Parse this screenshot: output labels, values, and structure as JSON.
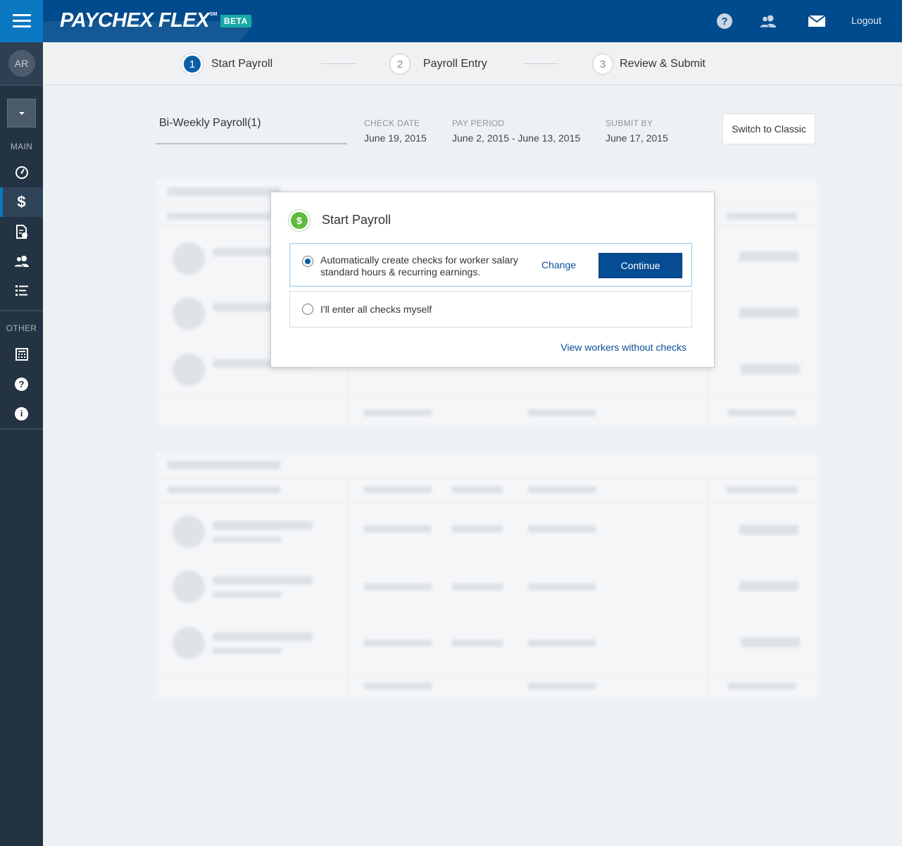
{
  "app": {
    "logo_text": "PAYCHEX FLEX",
    "logo_mark": "SM",
    "badge": "BETA",
    "logout_label": "Logout",
    "accent_color": "#004b8d"
  },
  "header_icons": [
    "help-icon",
    "people-icon",
    "mail-icon"
  ],
  "sidebar": {
    "avatar_initials": "AR",
    "section_main": "MAIN",
    "section_other": "OTHER",
    "main_items": [
      "dashboard-icon",
      "dollar-icon",
      "reports-icon",
      "people-icon",
      "list-icon"
    ],
    "other_items": [
      "calculator-icon",
      "help-icon",
      "info-icon"
    ]
  },
  "stepper": {
    "steps": [
      {
        "number": "1",
        "label": "Start Payroll",
        "active": true
      },
      {
        "number": "2",
        "label": "Payroll Entry",
        "active": false
      },
      {
        "number": "3",
        "label": "Review & Submit",
        "active": false
      }
    ]
  },
  "payroll": {
    "name": "Bi-Weekly Payroll(1)",
    "check_date_label": "CHECK DATE",
    "check_date": "June 19, 2015",
    "pay_period_label": "PAY PERIOD",
    "pay_period": "June 2, 2015 - June 13, 2015",
    "submit_by_label": "SUBMIT BY",
    "submit_by": "June 17, 2015",
    "switch_label": "Switch to Classic"
  },
  "modal": {
    "title": "Start Payroll",
    "option_auto_line1": "Automatically create checks for worker salary",
    "option_auto_line2": "standard hours & recurring earnings.",
    "change_label": "Change",
    "continue_label": "Continue",
    "option_manual": "I'll enter all checks myself",
    "view_workers_label": "View workers without checks"
  }
}
